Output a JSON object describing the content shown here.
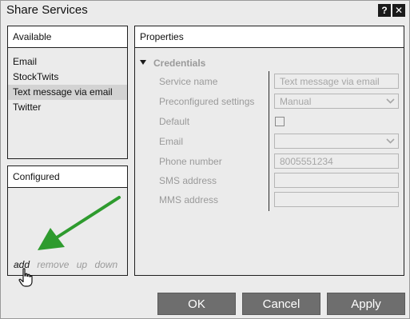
{
  "window": {
    "title": "Share Services",
    "help_label": "?",
    "close_label": "✕"
  },
  "available": {
    "header": "Available",
    "items": [
      {
        "label": "Email",
        "selected": false
      },
      {
        "label": "StockTwits",
        "selected": false
      },
      {
        "label": "Text message via email",
        "selected": true
      },
      {
        "label": "Twitter",
        "selected": false
      }
    ]
  },
  "configured": {
    "header": "Configured",
    "actions": {
      "add": "add",
      "remove": "remove",
      "up": "up",
      "down": "down"
    }
  },
  "properties": {
    "header": "Properties",
    "section": "Credentials",
    "fields": {
      "service_name": {
        "label": "Service name",
        "value": "Text message via email"
      },
      "preconfigured": {
        "label": "Preconfigured settings",
        "value": "Manual"
      },
      "default": {
        "label": "Default",
        "checked": false
      },
      "email": {
        "label": "Email",
        "value": ""
      },
      "phone": {
        "label": "Phone number",
        "value": "8005551234"
      },
      "sms": {
        "label": "SMS address",
        "value": ""
      },
      "mms": {
        "label": "MMS address",
        "value": ""
      }
    }
  },
  "buttons": {
    "ok": "OK",
    "cancel": "Cancel",
    "apply": "Apply"
  },
  "icons": {
    "annotation": "green-arrow-icon",
    "pointer": "hand-cursor-icon",
    "dropdown": "chevron-down-icon",
    "collapse": "triangle-down-icon"
  },
  "colors": {
    "arrow": "#2e9b2e",
    "button_bg": "#6e6e6e",
    "selection": "#d3d3d3"
  }
}
